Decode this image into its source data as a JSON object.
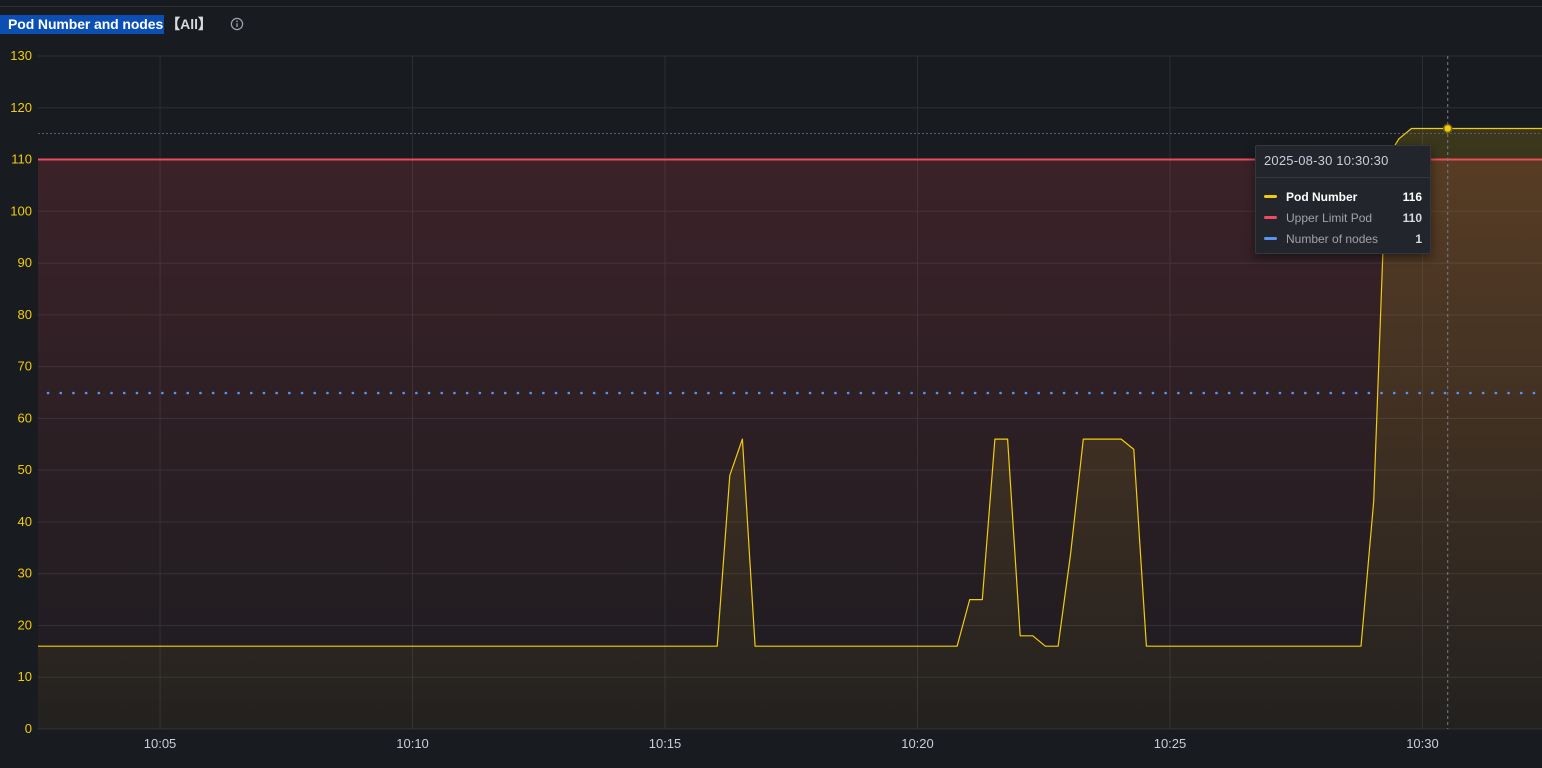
{
  "panel": {
    "title": "Pod Number and nodes",
    "scope": "【All】",
    "info_icon": "info-circle-icon"
  },
  "colors": {
    "background": "#181b1f",
    "pod_number": "#f2cc0c",
    "upper_limit": "#f2495c",
    "nodes": "#5794f2",
    "axis_text": "#f2cc0c",
    "grid": "#2c2f34"
  },
  "tooltip": {
    "time": "2025-08-30 10:30:30",
    "rows": [
      {
        "name": "Pod Number",
        "value": "116",
        "color": "#f2cc0c"
      },
      {
        "name": "Upper Limit Pod",
        "value": "110",
        "color": "#f2495c"
      },
      {
        "name": "Number of nodes",
        "value": "1",
        "color": "#5794f2"
      }
    ]
  },
  "chart_data": {
    "type": "line",
    "title": "Pod Number and nodes",
    "ylim": [
      0,
      130
    ],
    "yticks": [
      "0",
      "10",
      "20",
      "30",
      "40",
      "50",
      "60",
      "70",
      "80",
      "90",
      "100",
      "110",
      "120",
      "130"
    ],
    "xlim": [
      "10:02:35",
      "10:32:22"
    ],
    "xticks": [
      "10:05",
      "10:10",
      "10:15",
      "10:20",
      "10:25",
      "10:30"
    ],
    "grid": true,
    "hover_time": "10:30:30",
    "series": [
      {
        "name": "Pod Number",
        "color": "#f2cc0c",
        "style": "line-fill",
        "x": [
          "10:02:35",
          "10:16:02",
          "10:16:17",
          "10:16:32",
          "10:16:47",
          "10:20:47",
          "10:21:02",
          "10:21:17",
          "10:21:32",
          "10:21:47",
          "10:22:02",
          "10:22:17",
          "10:22:32",
          "10:22:47",
          "10:23:02",
          "10:23:17",
          "10:23:32",
          "10:23:47",
          "10:24:02",
          "10:24:17",
          "10:24:32",
          "10:28:47",
          "10:29:02",
          "10:29:17",
          "10:29:32",
          "10:29:47",
          "10:30:00",
          "10:30:30",
          "10:32:22"
        ],
        "values": [
          16,
          16,
          49,
          56,
          16,
          16,
          25,
          25,
          56,
          56,
          18,
          18,
          16,
          16,
          34,
          56,
          56,
          56,
          56,
          54,
          16,
          16,
          44,
          110,
          114,
          116,
          116,
          116,
          116
        ]
      },
      {
        "name": "Upper Limit Pod",
        "color": "#f2495c",
        "style": "line-gradient-fill",
        "x": [
          "10:02:35",
          "10:32:22"
        ],
        "values": [
          110,
          110
        ]
      },
      {
        "name": "Number of nodes",
        "color": "#5794f2",
        "style": "dots",
        "y_axis": "secondary",
        "x": [
          "10:02:35",
          "10:32:22"
        ],
        "values": [
          1,
          1
        ]
      }
    ]
  }
}
